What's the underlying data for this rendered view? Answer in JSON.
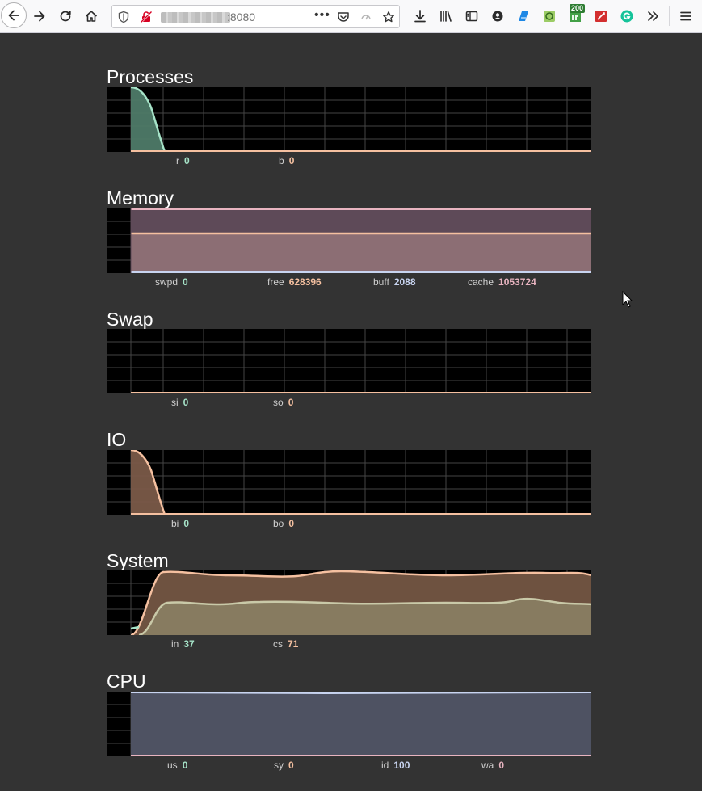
{
  "browser": {
    "url_port": ":8080",
    "extension_badge": "200"
  },
  "colors": {
    "green_series": "#a6e3c8",
    "peach_series": "#f5c0a0",
    "pink_series": "#e8b4c0",
    "lavender_series": "#c8d4f0",
    "tan_series": "#c9c9a8",
    "grid": "#444444",
    "background": "#333333"
  },
  "sections": {
    "processes": {
      "title": "Processes",
      "legend": [
        {
          "label": "r",
          "value": "0",
          "color": "#a6e3c8"
        },
        {
          "label": "b",
          "value": "0",
          "color": "#f5c0a0"
        }
      ]
    },
    "memory": {
      "title": "Memory",
      "legend": [
        {
          "label": "swpd",
          "value": "0",
          "color": "#a6e3c8"
        },
        {
          "label": "free",
          "value": "628396",
          "color": "#f5c0a0"
        },
        {
          "label": "buff",
          "value": "2088",
          "color": "#c8d4f0"
        },
        {
          "label": "cache",
          "value": "1053724",
          "color": "#e8b4c0"
        }
      ]
    },
    "swap": {
      "title": "Swap",
      "legend": [
        {
          "label": "si",
          "value": "0",
          "color": "#a6e3c8"
        },
        {
          "label": "so",
          "value": "0",
          "color": "#f5c0a0"
        }
      ]
    },
    "io": {
      "title": "IO",
      "legend": [
        {
          "label": "bi",
          "value": "0",
          "color": "#a6e3c8"
        },
        {
          "label": "bo",
          "value": "0",
          "color": "#f5c0a0"
        }
      ]
    },
    "system": {
      "title": "System",
      "legend": [
        {
          "label": "in",
          "value": "37",
          "color": "#a6e3c8"
        },
        {
          "label": "cs",
          "value": "71",
          "color": "#f5c0a0"
        }
      ]
    },
    "cpu": {
      "title": "CPU",
      "legend": [
        {
          "label": "us",
          "value": "0",
          "color": "#a6e3c8"
        },
        {
          "label": "sy",
          "value": "0",
          "color": "#f5c0a0"
        },
        {
          "label": "id",
          "value": "100",
          "color": "#c8d4f0"
        },
        {
          "label": "wa",
          "value": "0",
          "color": "#e8b4c0"
        }
      ]
    }
  }
}
